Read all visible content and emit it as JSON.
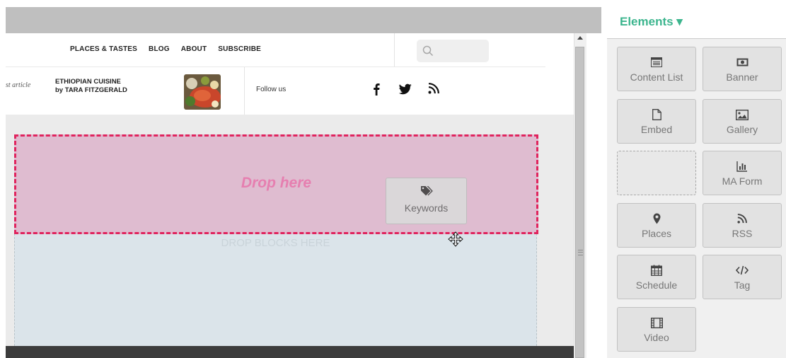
{
  "site": {
    "nav": [
      "PLACES & TASTES",
      "BLOG",
      "ABOUT",
      "SUBSCRIBE"
    ],
    "latest_label": "st article",
    "article": {
      "line1": "ETHIOPIAN CUISINE",
      "line2": "by TARA FITZGERALD"
    },
    "follow_label": "Follow us",
    "social_icons": [
      "facebook-icon",
      "twitter-icon",
      "rss-icon"
    ],
    "search_icon": "search-icon"
  },
  "canvas": {
    "drop_here": "Drop here",
    "drop_blocks": "DROP BLOCKS HERE",
    "dragging": {
      "label": "Keywords",
      "icon": "tags-icon"
    }
  },
  "panel": {
    "title": "Elements ▾",
    "items": [
      {
        "label": "Content List",
        "icon": "list-icon"
      },
      {
        "label": "Banner",
        "icon": "banner-icon"
      },
      {
        "label": "Embed",
        "icon": "file-icon"
      },
      {
        "label": "Gallery",
        "icon": "image-icon"
      },
      {
        "label": "",
        "icon": ""
      },
      {
        "label": "MA Form",
        "icon": "chart-icon"
      },
      {
        "label": "Places",
        "icon": "map-marker-icon"
      },
      {
        "label": "RSS",
        "icon": "rss-icon"
      },
      {
        "label": "Schedule",
        "icon": "calendar-icon"
      },
      {
        "label": "Tag",
        "icon": "code-icon"
      },
      {
        "label": "Video",
        "icon": "film-icon"
      }
    ]
  },
  "colors": {
    "accent": "#3cb58e",
    "drop_border": "#e0245e",
    "drop_fill": "#dfbcd0",
    "drop_text": "#e67fb0",
    "blocks_fill": "#dbe4ea"
  }
}
